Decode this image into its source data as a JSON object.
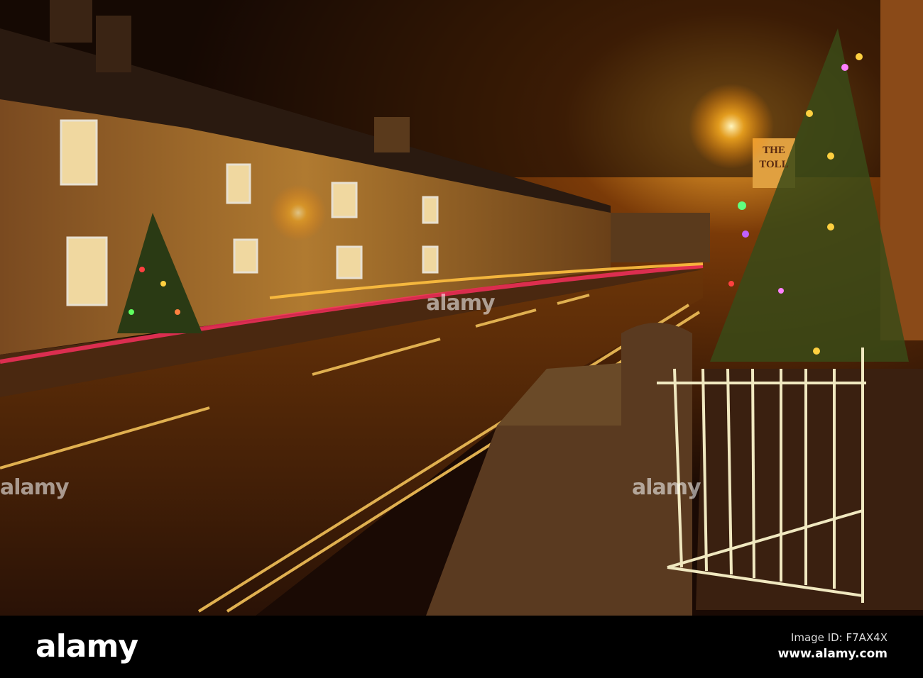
{
  "photo": {
    "subject": "Village street at night with Christmas trees and light trails",
    "sign_text": "THE TOLL"
  },
  "watermark": {
    "center": "alamy",
    "left": "alamy",
    "right": "alamy"
  },
  "footer": {
    "logo": "alamy",
    "image_id": "Image ID: F7AX4X",
    "url": "www.alamy.com"
  }
}
